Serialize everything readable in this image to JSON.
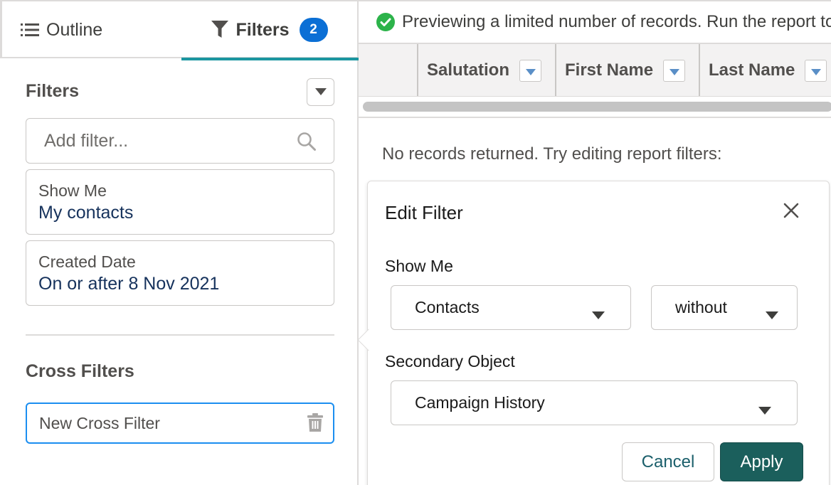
{
  "tabs": {
    "outline_label": "Outline",
    "filters_label": "Filters",
    "filters_count": "2"
  },
  "filters_panel": {
    "title": "Filters",
    "add_filter_placeholder": "Add filter...",
    "cards": [
      {
        "label": "Show Me",
        "value": "My contacts"
      },
      {
        "label": "Created Date",
        "value": "On or after 8 Nov 2021"
      }
    ],
    "cross_filters_title": "Cross Filters",
    "new_cross_filter_label": "New Cross Filter"
  },
  "report": {
    "banner_text": "Previewing a limited number of records. Run the report to see everything.",
    "columns": [
      "Salutation",
      "First Name",
      "Last Name"
    ],
    "empty_message": "No records returned. Try editing report filters:"
  },
  "edit_filter": {
    "title": "Edit Filter",
    "show_me_label": "Show Me",
    "show_me_value": "Contacts",
    "relation_value": "without",
    "secondary_object_label": "Secondary Object",
    "secondary_object_value": "Campaign History",
    "cancel_label": "Cancel",
    "apply_label": "Apply"
  },
  "colors": {
    "accent_tab": "#1b96a0",
    "badge": "#0b6fd5",
    "apply_button": "#1b5f5c",
    "success_check": "#2cb34a",
    "focus_border": "#1b8ef0"
  }
}
